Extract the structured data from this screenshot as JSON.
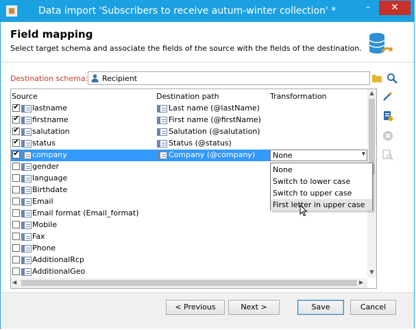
{
  "window": {
    "title": "Data import 'Subscribers to receive autum-winter collection' *",
    "minimize": "–",
    "close": "✕"
  },
  "header": {
    "title": "Field mapping",
    "subtitle": "Select target schema and associate the fields of the source with the fields of the destination."
  },
  "destination": {
    "label": "Destination schema:",
    "value": "Recipient"
  },
  "columns": {
    "source": "Source",
    "destination": "Destination path",
    "transformation": "Transformation"
  },
  "rows": [
    {
      "source": "lastname",
      "destination": "Last name (@lastName)",
      "checked": true
    },
    {
      "source": "firstname",
      "destination": "First name (@firstName)",
      "checked": true
    },
    {
      "source": "salutation",
      "destination": "Salutation (@salutation)",
      "checked": true
    },
    {
      "source": "status",
      "destination": "Status (@status)",
      "checked": true
    },
    {
      "source": "company",
      "destination": "Company (@company)",
      "checked": true,
      "selected": true,
      "transformation": "None"
    },
    {
      "source": "gender",
      "destination": "",
      "checked": false
    },
    {
      "source": "language",
      "destination": "",
      "checked": false
    },
    {
      "source": "Birthdate",
      "destination": "",
      "checked": false
    },
    {
      "source": "Email",
      "destination": "",
      "checked": false
    },
    {
      "source": "Email format (Email_format)",
      "destination": "",
      "checked": false
    },
    {
      "source": "Mobile",
      "destination": "",
      "checked": false
    },
    {
      "source": "Fax",
      "destination": "",
      "checked": false
    },
    {
      "source": "Phone",
      "destination": "",
      "checked": false
    },
    {
      "source": "AdditionalRcp",
      "destination": "",
      "checked": false
    },
    {
      "source": "AdditionalGeo",
      "destination": "",
      "checked": false
    }
  ],
  "transformation_options": [
    "None",
    "Switch to lower case",
    "Switch to upper case",
    "First letter in upper case"
  ],
  "buttons": {
    "previous": "< Previous",
    "next": "Next >",
    "save": "Save",
    "cancel": "Cancel"
  }
}
